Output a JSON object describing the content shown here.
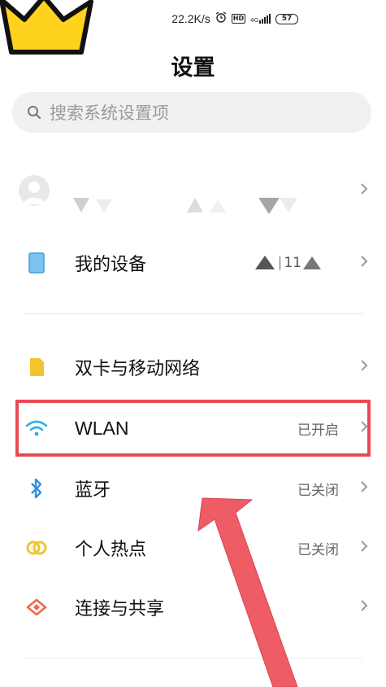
{
  "status_bar": {
    "network_speed": "22.2K/s",
    "hd": "HD",
    "network_type": "4G",
    "battery": "57"
  },
  "header": {
    "title": "设置"
  },
  "search": {
    "placeholder": "搜索系统设置项"
  },
  "device": {
    "label": "我的设备",
    "value": "11"
  },
  "rows": [
    {
      "label": "双卡与移动网络",
      "value": "",
      "icon": "sim-card-icon",
      "color": "#f5c230"
    },
    {
      "label": "WLAN",
      "value": "已开启",
      "icon": "wifi-icon",
      "color": "#2fb0e8"
    },
    {
      "label": "蓝牙",
      "value": "已关闭",
      "icon": "bluetooth-icon",
      "color": "#2f8fe8"
    },
    {
      "label": "个人热点",
      "value": "已关闭",
      "icon": "hotspot-icon",
      "color": "#f0c530"
    },
    {
      "label": "连接与共享",
      "value": "",
      "icon": "connection-share-icon",
      "color": "#ee6a4b"
    }
  ],
  "colors": {
    "highlight": "#e84b55",
    "arrow": "#ee5c66"
  }
}
